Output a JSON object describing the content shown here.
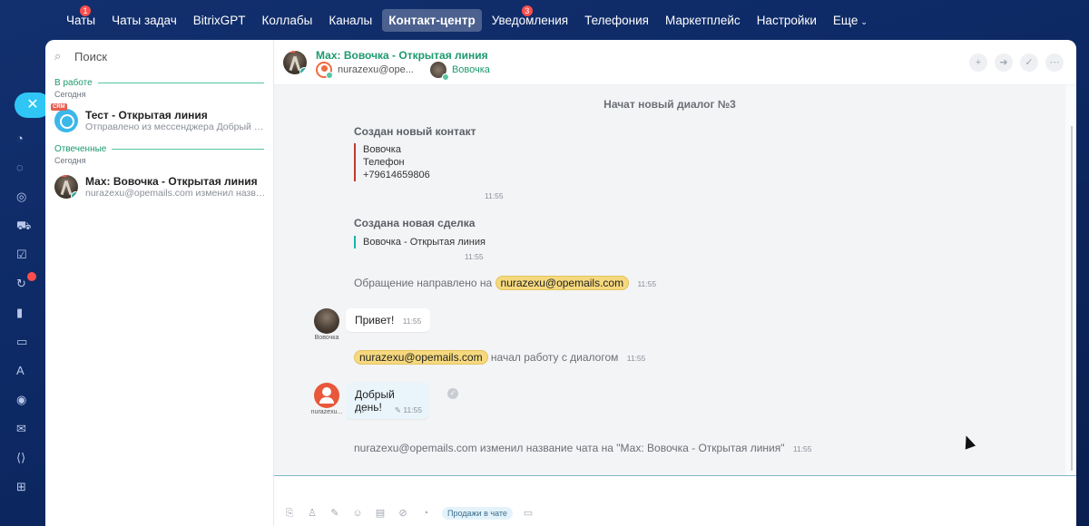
{
  "topnav": {
    "items": [
      {
        "label": "Чаты",
        "badge": "1"
      },
      {
        "label": "Чаты задач"
      },
      {
        "label": "BitrixGPT"
      },
      {
        "label": "Коллабы"
      },
      {
        "label": "Каналы"
      },
      {
        "label": "Контакт-центр",
        "active": true
      },
      {
        "label": "Уведомления",
        "badge": "3"
      },
      {
        "label": "Телефония"
      },
      {
        "label": "Маркетплейс"
      },
      {
        "label": "Настройки"
      },
      {
        "label": "Еще"
      }
    ]
  },
  "recent": {
    "search_placeholder": "Поиск",
    "sections": [
      {
        "title": "В работе",
        "day": "Сегодня",
        "chat": {
          "title": "Тест - Открытая линия",
          "sub": "Отправлено из мессенджера Добрый день!"
        }
      },
      {
        "title": "Отвеченные",
        "day": "Сегодня",
        "chat": {
          "title": "Мах: Вовочка - Открытая линия",
          "sub": "nurazexu@opemails.com изменил названи..."
        }
      }
    ],
    "crm_tag": "CRM"
  },
  "dialog": {
    "title": "Мах: Вовочка - Открытая линия",
    "operator": "nurazexu@ope...",
    "client": "Вовочка",
    "new_dialog": "Начат новый диалог №3",
    "contact": {
      "heading": "Создан новый контакт",
      "name": "Вовочка",
      "phone_label": "Телефон",
      "phone": "+79614659806",
      "time": "11:55"
    },
    "deal": {
      "heading": "Создана новая сделка",
      "name": "Вовочка - Открытая линия",
      "time": "11:55"
    },
    "routed": {
      "text": "Обращение направлено на",
      "mention": "nurazexu@opemails.com",
      "time": "11:55"
    },
    "msg1": {
      "text": "Привет!",
      "time": "11:55",
      "author": "Вовочка"
    },
    "started": {
      "mention": "nurazexu@opemails.com",
      "text": "начал работу с диалогом",
      "time": "11:55"
    },
    "msg2": {
      "text": "Добрый день!",
      "time": "11:55",
      "author": "nurazexu..."
    },
    "renamed": {
      "text": "nurazexu@opemails.com изменил название чата на \"Мах: Вовочка - Открытая линия\"",
      "time": "11:55"
    }
  },
  "composer": {
    "sales_button": "Продажи в чате"
  },
  "colors": {
    "accent": "#2fc6f6",
    "brand_green": "#1d9a6c",
    "mention": "#f6d97e"
  }
}
